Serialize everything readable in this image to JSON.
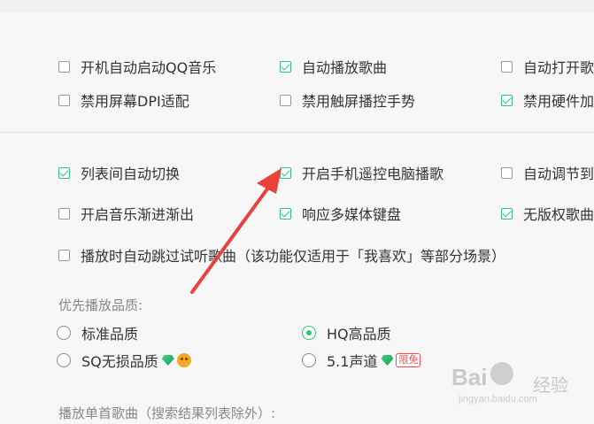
{
  "general": {
    "opt_autostart": "开机自动启动QQ音乐",
    "opt_autoplay": "自动播放歌曲",
    "opt_autoopen": "自动打开歌",
    "opt_disable_dpi": "禁用屏幕DPI适配",
    "opt_disable_touch": "禁用触屏播控手势",
    "opt_disable_hw": "禁用硬件加"
  },
  "playback": {
    "opt_list_switch": "列表间自动切换",
    "opt_phone_remote": "开启手机遥控电脑播歌",
    "opt_auto_adjust": "自动调节到",
    "opt_fade": "开启音乐渐进渐出",
    "opt_media_keys": "响应多媒体键盘",
    "opt_no_copyright": "无版权歌曲",
    "opt_skip_trial": "播放时自动跳过试听歌曲（该功能仅适用于「我喜欢」等部分场景）"
  },
  "quality": {
    "heading": "优先播放品质:",
    "standard": "标准品质",
    "hq": "HQ高品质",
    "sq": "SQ无损品质",
    "surround": "5.1声道",
    "limited_tag": "限免"
  },
  "single_song": {
    "heading": "播放单首歌曲（搜索结果列表除外）:"
  },
  "checked": {
    "autostart": false,
    "autoplay": true,
    "autoopen": false,
    "disable_dpi": false,
    "disable_touch": false,
    "disable_hw": true,
    "list_switch": true,
    "phone_remote": true,
    "auto_adjust": false,
    "fade": false,
    "media_keys": true,
    "no_copyright": true,
    "skip_trial": false
  },
  "selected_quality": "hq",
  "colors": {
    "accent": "#31c27c",
    "arrow": "#e8423a",
    "tag": "#ff4a4a"
  },
  "icons": [
    "checkbox-icon",
    "radio-icon",
    "diamond-vip-icon",
    "monkey-badge-icon",
    "annotation-arrow-icon"
  ],
  "watermark": {
    "brand": "Bai",
    "brand_cn": "经验",
    "url": "jingyan.baidu.com"
  }
}
